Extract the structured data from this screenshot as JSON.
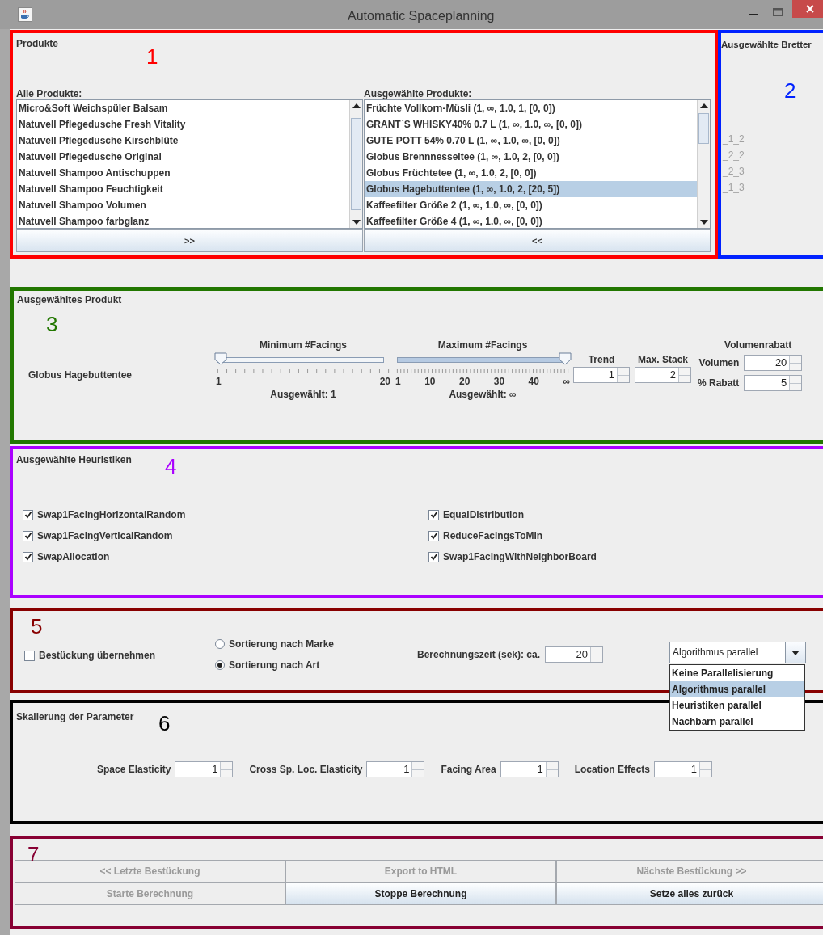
{
  "window": {
    "title": "Automatic Spaceplanning"
  },
  "products": {
    "title": "Produkte",
    "marker": "1",
    "color": "#ff0000",
    "all_label": "Alle Produkte:",
    "all_items": [
      "Micro&Soft Weichspüler Balsam",
      "Natuvell Pflegedusche Fresh Vitality",
      "Natuvell Pflegedusche Kirschblüte",
      "Natuvell Pflegedusche Original",
      "Natuvell Shampoo Antischuppen",
      "Natuvell Shampoo Feuchtigkeit",
      "Natuvell Shampoo Volumen",
      "Natuvell Shampoo farbglanz"
    ],
    "selected_label": "Ausgewählte Produkte:",
    "selected_items": [
      {
        "text": "Früchte Vollkorn-Müsli (1, ∞, 1.0, 1, [0, 0])",
        "selected": false
      },
      {
        "text": "GRANT`S WHISKY40% 0.7 L (1, ∞, 1.0, ∞, [0, 0])",
        "selected": false
      },
      {
        "text": "GUTE POTT 54% 0.70 L (1, ∞, 1.0, ∞, [0, 0])",
        "selected": false
      },
      {
        "text": "Globus Brennnesseltee (1, ∞, 1.0, 2, [0, 0])",
        "selected": false
      },
      {
        "text": "Globus Früchtetee (1, ∞, 1.0, 2, [0, 0])",
        "selected": false
      },
      {
        "text": "Globus Hagebuttentee (1, ∞, 1.0, 2, [20, 5])",
        "selected": true
      },
      {
        "text": "Kaffeefilter Größe 2 (1, ∞, 1.0, ∞, [0, 0])",
        "selected": false
      },
      {
        "text": "Kaffeefilter Größe 4 (1, ∞, 1.0, ∞, [0, 0])",
        "selected": false
      }
    ],
    "add_button": ">>",
    "remove_button": "<<"
  },
  "boards": {
    "title": "Ausgewählte Bretter",
    "marker": "2",
    "color": "#0022ff",
    "items": [
      {
        "text": "_1_2",
        "disabled": true
      },
      {
        "text": "_2_2",
        "disabled": true
      },
      {
        "text": "_2_3",
        "disabled": true
      },
      {
        "text": "_1_3",
        "disabled": true
      }
    ]
  },
  "selected_product": {
    "title": "Ausgewähltes Produkt",
    "marker": "3",
    "color": "#227700",
    "name": "Globus Hagebuttentee",
    "min_slider": {
      "label": "Minimum #Facings",
      "level": 0,
      "tick_labels": [
        "1",
        "20"
      ],
      "reading": "Ausgewählt: 1"
    },
    "max_slider": {
      "label": "Maximum #Facings",
      "level": 1,
      "tick_labels": [
        "1",
        "10",
        "20",
        "30",
        "40",
        "∞"
      ],
      "reading": "Ausgewählt: ∞"
    },
    "trend": {
      "label": "Trend",
      "value": "1"
    },
    "max_stack": {
      "label": "Max. Stack",
      "value": "2"
    },
    "discount": {
      "title": "Volumenrabatt",
      "fields": [
        {
          "label": "Volumen",
          "value": "20"
        },
        {
          "label": "% Rabatt",
          "value": "5"
        }
      ]
    }
  },
  "heuristics": {
    "title": "Ausgewählte Heuristiken",
    "marker": "4",
    "color": "#aa00ff",
    "items": [
      {
        "label": "Swap1FacingHorizontalRandom",
        "checked": true
      },
      {
        "label": "EqualDistribution",
        "checked": true
      },
      {
        "label": "Swap1FacingVerticalRandom",
        "checked": true
      },
      {
        "label": "ReduceFacingsToMin",
        "checked": true
      },
      {
        "label": "SwapAllocation",
        "checked": true
      },
      {
        "label": "Swap1FacingWithNeighborBoard",
        "checked": true
      }
    ]
  },
  "options": {
    "marker": "5",
    "color": "#880000",
    "adopt": {
      "label": "Bestückung übernehmen",
      "checked": false
    },
    "sorting": [
      {
        "label": "Sortierung nach Marke",
        "selected": false
      },
      {
        "label": "Sortierung nach Art",
        "selected": true
      }
    ],
    "time": {
      "label": "Berechnungszeit (sek): ca.",
      "value": "20"
    },
    "mode": {
      "value": "Algorithmus parallel",
      "expanded": true,
      "options": [
        {
          "label": "Keine Parallelisierung",
          "selected": false
        },
        {
          "label": "Algorithmus parallel",
          "selected": true
        },
        {
          "label": "Heuristiken parallel",
          "selected": false
        },
        {
          "label": "Nachbarn parallel",
          "selected": false
        }
      ]
    }
  },
  "scaling": {
    "title": "Skalierung der Parameter",
    "marker": "6",
    "color": "#000000",
    "params": [
      {
        "label": "Space Elasticity",
        "value": "1"
      },
      {
        "label": "Cross Sp. Loc. Elasticity",
        "value": "1"
      },
      {
        "label": "Facing Area",
        "value": "1"
      },
      {
        "label": "Location Effects",
        "value": "1"
      }
    ]
  },
  "actions": {
    "marker": "7",
    "color": "#880033",
    "buttons": [
      {
        "label": "<< Letzte Bestückung",
        "disabled": true
      },
      {
        "label": "Export to HTML",
        "disabled": true
      },
      {
        "label": "Nächste Bestückung >>",
        "disabled": true
      },
      {
        "label": "Starte Berechnung",
        "disabled": true
      },
      {
        "label": "Stoppe Berechnung",
        "disabled": false
      },
      {
        "label": "Setze alles zurück",
        "disabled": false
      }
    ]
  }
}
